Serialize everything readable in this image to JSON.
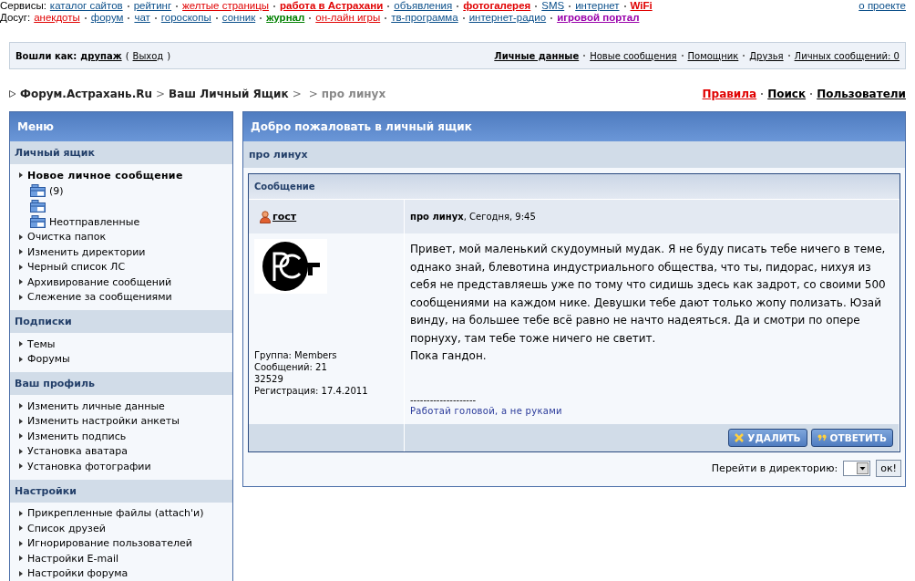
{
  "top_rows": [
    {
      "label": "Сервисы:",
      "links": [
        {
          "text": "каталог сайтов",
          "color": "#0b4f8a",
          "bold": false
        },
        {
          "text": "рейтинг",
          "color": "#0b4f8a",
          "bold": false
        },
        {
          "text": "желтые страницы",
          "color": "#e00000",
          "bold": false
        },
        {
          "text": "работа в Астрахани",
          "color": "#e00000",
          "bold": true
        },
        {
          "text": "объявления",
          "color": "#0b4f8a",
          "bold": false
        },
        {
          "text": "фотогалерея",
          "color": "#e00000",
          "bold": true
        },
        {
          "text": "SMS",
          "color": "#0b4f8a",
          "bold": false
        },
        {
          "text": "интернет",
          "color": "#0b4f8a",
          "bold": false
        },
        {
          "text": "WiFi",
          "color": "#e00000",
          "bold": true
        }
      ]
    },
    {
      "label": "Досуг:",
      "links": [
        {
          "text": "анекдоты",
          "color": "#e00000",
          "bold": false
        },
        {
          "text": "форум",
          "color": "#0b4f8a",
          "bold": false
        },
        {
          "text": "чат",
          "color": "#0b4f8a",
          "bold": false
        },
        {
          "text": "гороскопы",
          "color": "#0b4f8a",
          "bold": false
        },
        {
          "text": "сонник",
          "color": "#0b4f8a",
          "bold": false
        },
        {
          "text": "журнал",
          "color": "#008000",
          "bold": true
        },
        {
          "text": "он-лайн игры",
          "color": "#e00000",
          "bold": false
        },
        {
          "text": "тв-программа",
          "color": "#0b4f8a",
          "bold": false
        },
        {
          "text": "интернет-радио",
          "color": "#0b4f8a",
          "bold": false
        },
        {
          "text": "игровой портал",
          "color": "#9900aa",
          "bold": true
        }
      ]
    }
  ],
  "about_link": "о проекте",
  "userbar": {
    "label": "Вошли как:",
    "user": "друпаж",
    "open_paren": "(",
    "logout": "Выход",
    "close_paren": ")",
    "links": [
      {
        "text": "Личные данные",
        "bold": true
      },
      {
        "text": "Новые сообщения",
        "bold": false
      },
      {
        "text": "Помощник",
        "bold": false
      },
      {
        "text": "Друзья",
        "bold": false
      },
      {
        "text": "Личных сообщений: 0",
        "bold": false
      }
    ]
  },
  "breadcrumb": {
    "parts": [
      {
        "kind": "link",
        "text": "Форум.Астрахань.Ru"
      },
      {
        "kind": "separator",
        "text": ">"
      },
      {
        "kind": "link",
        "text": "Ваш Личный Ящик"
      },
      {
        "kind": "separator",
        "text": ">"
      },
      {
        "kind": "separator",
        "text": ">"
      },
      {
        "kind": "current",
        "text": "про линух"
      }
    ]
  },
  "nav_links": [
    {
      "text": "Правила",
      "color": "#e00000"
    },
    {
      "text": "Поиск",
      "color": "#000000"
    },
    {
      "text": "Пользователи",
      "color": "#000000"
    }
  ],
  "sidebar": {
    "title": "Меню",
    "sections": [
      {
        "title": "Личный ящик",
        "items": [
          {
            "kind": "link",
            "text": "Новое личное сообщение",
            "bold": true
          },
          {
            "kind": "folder",
            "text": "(9)"
          },
          {
            "kind": "folder"
          },
          {
            "kind": "folder",
            "text": "Неотправленные"
          },
          {
            "kind": "link",
            "text": "Очистка папок",
            "bold": false
          },
          {
            "kind": "link",
            "text": "Изменить директории",
            "bold": false
          },
          {
            "kind": "link",
            "text": "Черный список ЛС",
            "bold": false
          },
          {
            "kind": "link",
            "text": "Архивирование сообщений",
            "bold": false
          },
          {
            "kind": "link",
            "text": "Слежение за сообщениями",
            "bold": false
          }
        ]
      },
      {
        "title": "Подписки",
        "items": [
          {
            "kind": "link",
            "text": "Темы",
            "bold": false
          },
          {
            "kind": "link",
            "text": "Форумы",
            "bold": false
          }
        ]
      },
      {
        "title": "Ваш профиль",
        "items": [
          {
            "kind": "link",
            "text": "Изменить личные данные",
            "bold": false
          },
          {
            "kind": "link",
            "text": "Изменить настройки анкеты",
            "bold": false
          },
          {
            "kind": "link",
            "text": "Изменить подпись",
            "bold": false
          },
          {
            "kind": "link",
            "text": "Установка аватара",
            "bold": false
          },
          {
            "kind": "link",
            "text": "Установка фотографии",
            "bold": false
          }
        ]
      },
      {
        "title": "Настройки",
        "items": [
          {
            "kind": "link",
            "text": "Прикрепленные файлы (attach'и)",
            "bold": false
          },
          {
            "kind": "link",
            "text": "Список друзей",
            "bold": false
          },
          {
            "kind": "link",
            "text": "Игнорирование пользователей",
            "bold": false
          },
          {
            "kind": "link",
            "text": "Настройки E-mail",
            "bold": false
          },
          {
            "kind": "link",
            "text": "Настройки форума",
            "bold": false
          }
        ]
      }
    ]
  },
  "main": {
    "title": "Добро пожаловать в личный ящик",
    "subject": "про линух",
    "message": {
      "header": "Сообщение",
      "author": "гост",
      "meta": "**про линух**, Сегодня, 9:45",
      "author_info": [
        "Группа: Members",
        "Сообщений: 21",
        "32529",
        "Регистрация: 17.4.2011"
      ],
      "body": [
        "Привет, мой маленький скудоумный мудак. Я не буду писать тебе ничего в теме, однако знай, блевотина индустриального общества, что ты, пидорас, нихуя из себя не представляешь уже по тому что сидишь здесь как задрот, со своими 500 сообщениями на каждом нике. Девушки тебе дают только жопу полизать. Юзай винду, на большее тебе всё равно не начто надеяться. Да и смотри по опере порнуху, там тебе тоже ничего не светит.",
        "Пока гандон."
      ],
      "signature_rule": "--------------------",
      "signature": "Работай головой, а не руками",
      "buttons": [
        {
          "kind": "delete",
          "label": "УДАЛИТЬ"
        },
        {
          "kind": "reply",
          "label": "ОТВЕТИТЬ"
        }
      ]
    },
    "goto_label": "Перейти в директорию:",
    "goto_button": "ок!"
  }
}
